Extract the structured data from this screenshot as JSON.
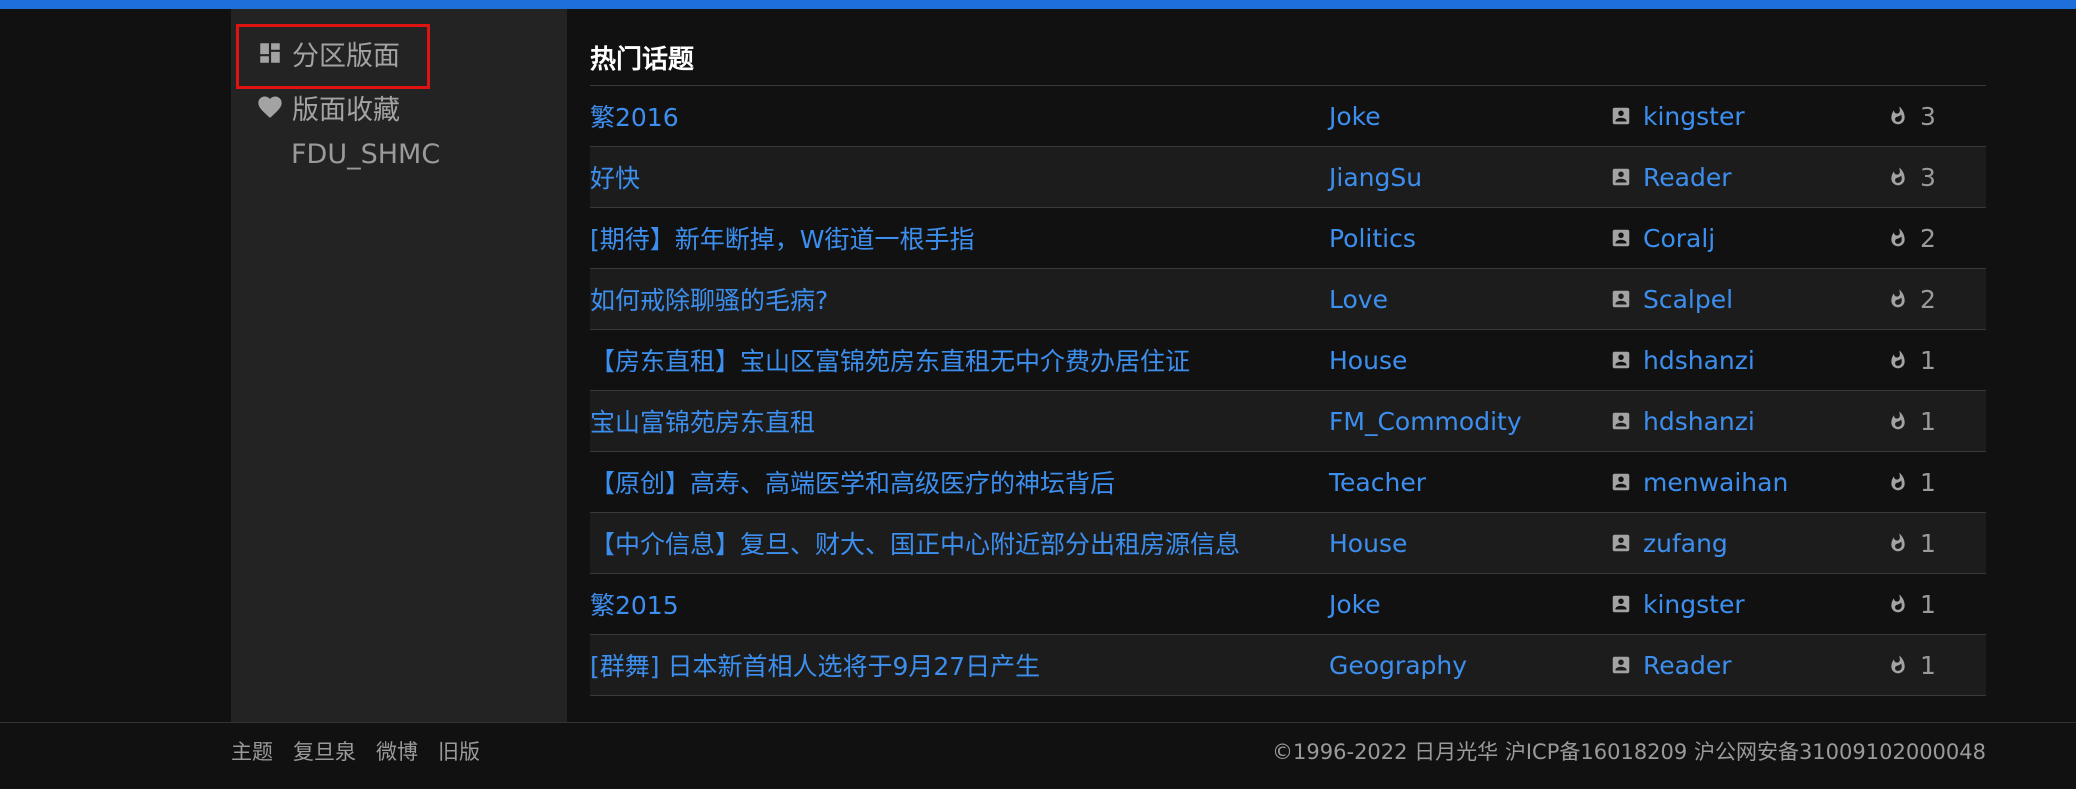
{
  "colors": {
    "accent": "#1e6fd9",
    "link": "#3d8fef",
    "background": "#111111",
    "sidebar_bg": "#232323",
    "highlight": "#e01313"
  },
  "sidebar": {
    "items": [
      {
        "label": "分区版面",
        "icon": "dashboard-icon"
      },
      {
        "label": "版面收藏",
        "icon": "heart-icon"
      }
    ],
    "favorites": [
      "FDU_SHMC"
    ]
  },
  "main": {
    "title": "热门话题",
    "topics": [
      {
        "title": "繁2016",
        "board": "Joke",
        "user": "kingster",
        "hot": "3"
      },
      {
        "title": "好快",
        "board": "JiangSu",
        "user": "Reader",
        "hot": "3"
      },
      {
        "title": "[期待】新年断掉，W街道一根手指",
        "board": "Politics",
        "user": "Coralj",
        "hot": "2"
      },
      {
        "title": "如何戒除聊骚的毛病?",
        "board": "Love",
        "user": "Scalpel",
        "hot": "2"
      },
      {
        "title": "【房东直租】宝山区富锦苑房东直租无中介费办居住证",
        "board": "House",
        "user": "hdshanzi",
        "hot": "1"
      },
      {
        "title": "宝山富锦苑房东直租",
        "board": "FM_Commodity",
        "user": "hdshanzi",
        "hot": "1"
      },
      {
        "title": "【原创】高寿、高端医学和高级医疗的神坛背后",
        "board": "Teacher",
        "user": "menwaihan",
        "hot": "1"
      },
      {
        "title": "【中介信息】复旦、财大、国正中心附近部分出租房源信息",
        "board": "House",
        "user": "zufang",
        "hot": "1"
      },
      {
        "title": "繁2015",
        "board": "Joke",
        "user": "kingster",
        "hot": "1"
      },
      {
        "title": "[群舞] 日本新首相人选将于9月27日产生",
        "board": "Geography",
        "user": "Reader",
        "hot": "1"
      }
    ]
  },
  "footer": {
    "links": [
      "主题",
      "复旦泉",
      "微博",
      "旧版"
    ],
    "copyright": "©1996-2022 日月光华 沪ICP备16018209 沪公网安备31009102000048"
  }
}
